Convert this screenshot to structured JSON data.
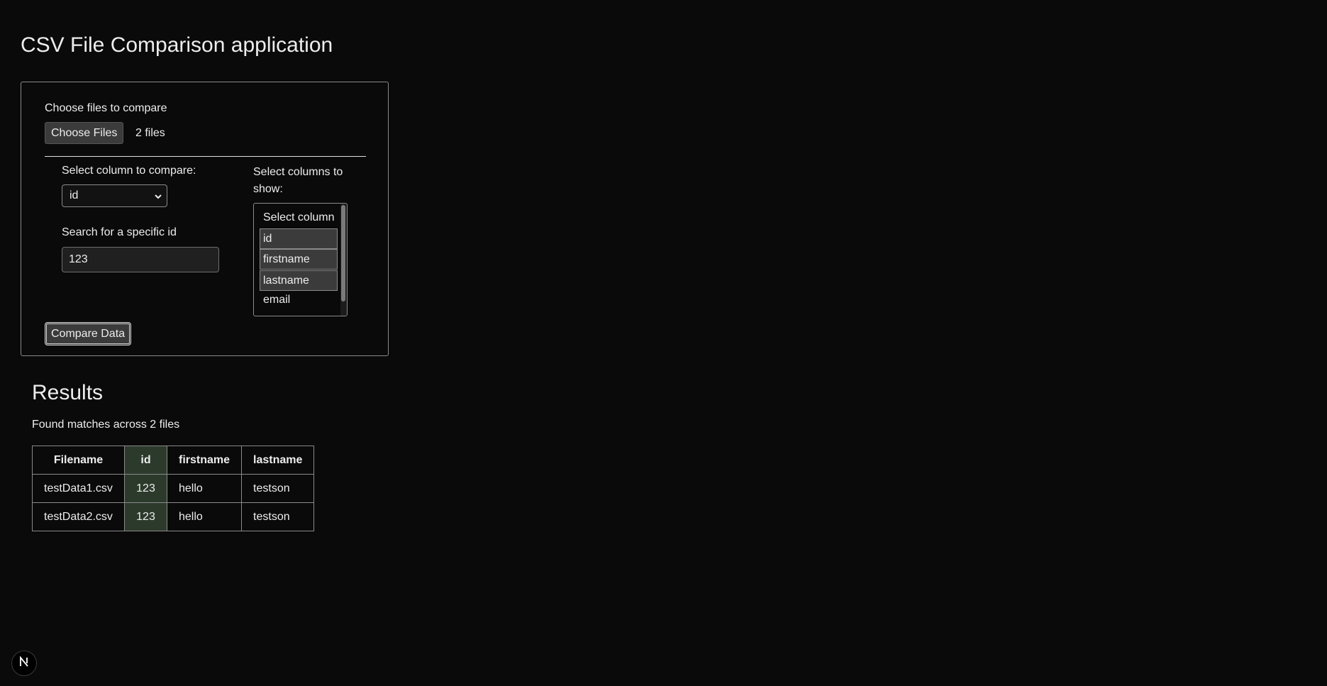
{
  "app": {
    "title": "CSV File Comparison application"
  },
  "form": {
    "choose_label": "Choose files to compare",
    "choose_button": "Choose Files",
    "file_count": "2 files",
    "compare_column_label": "Select column to compare:",
    "compare_column_value": "id",
    "search_label": "Search for a specific id",
    "search_value": "123",
    "show_columns_label": "Select columns to show:",
    "show_columns_options": [
      {
        "label": "Select column",
        "selected": false
      },
      {
        "label": "id",
        "selected": true
      },
      {
        "label": "firstname",
        "selected": true
      },
      {
        "label": "lastname",
        "selected": true
      },
      {
        "label": "email",
        "selected": false
      }
    ],
    "compare_button": "Compare Data"
  },
  "results": {
    "heading": "Results",
    "summary": "Found matches across 2 files",
    "columns": [
      "Filename",
      "id",
      "firstname",
      "lastname"
    ],
    "rows": [
      [
        "testData1.csv",
        "123",
        "hello",
        "testson"
      ],
      [
        "testData2.csv",
        "123",
        "hello",
        "testson"
      ]
    ]
  },
  "badge": {
    "letter": "N",
    "icon": "nextjs-logo-icon"
  },
  "colors": {
    "background": "#0a0a0a",
    "text": "#ededed",
    "highlight_column": "#2c3a2c"
  }
}
